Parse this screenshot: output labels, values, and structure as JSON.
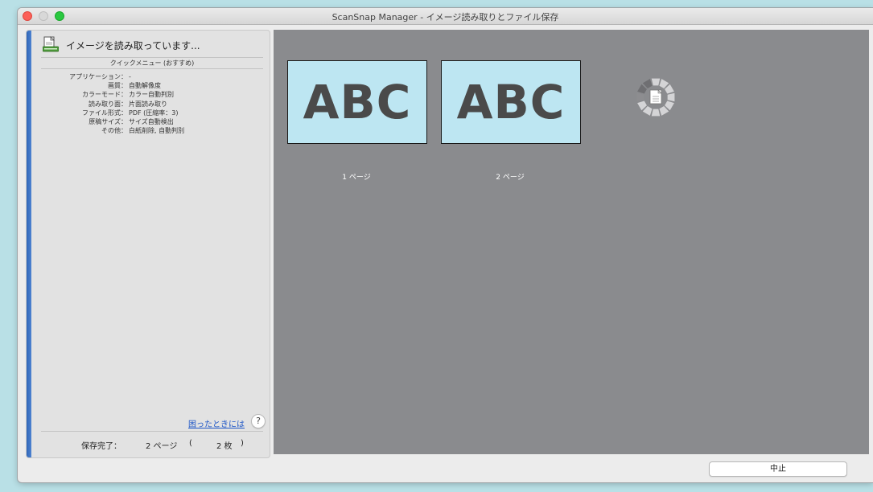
{
  "window": {
    "title": "ScanSnap Manager - イメージ読み取りとファイル保存"
  },
  "status": {
    "text": "イメージを読み取っています..."
  },
  "quick_menu": "クイックメニュー (おすすめ)",
  "settings": [
    {
      "label": "アプリケーション：",
      "value": "-"
    },
    {
      "label": "画質：",
      "value": "自動解像度"
    },
    {
      "label": "カラーモード：",
      "value": "カラー自動判別"
    },
    {
      "label": "読み取り面：",
      "value": "片面読み取り"
    },
    {
      "label": "ファイル形式：",
      "value": "PDF (圧縮率：3)"
    },
    {
      "label": "原稿サイズ：",
      "value": "サイズ自動検出"
    },
    {
      "label": "その他：",
      "value": "白紙削除, 自動判別"
    }
  ],
  "help": {
    "link": "困ったときには",
    "button": "?"
  },
  "saved": {
    "label": "保存完了：",
    "pages": "2 ページ",
    "open_paren": "(",
    "sheets": "2 枚",
    "close_paren": ")"
  },
  "pages": [
    {
      "thumb_text": "ABC",
      "label": "1 ページ"
    },
    {
      "thumb_text": "ABC",
      "label": "2 ページ"
    }
  ],
  "buttons": {
    "stop": "中止"
  },
  "colors": {
    "accent_bar": "#3a6fc2",
    "preview_bg": "#8a8b8e",
    "thumb_bg": "#bde6f2",
    "link": "#1f57c7"
  },
  "icons": {
    "status": "scan-document-icon",
    "spinner": "loading-spinner-icon",
    "help": "help-icon"
  }
}
